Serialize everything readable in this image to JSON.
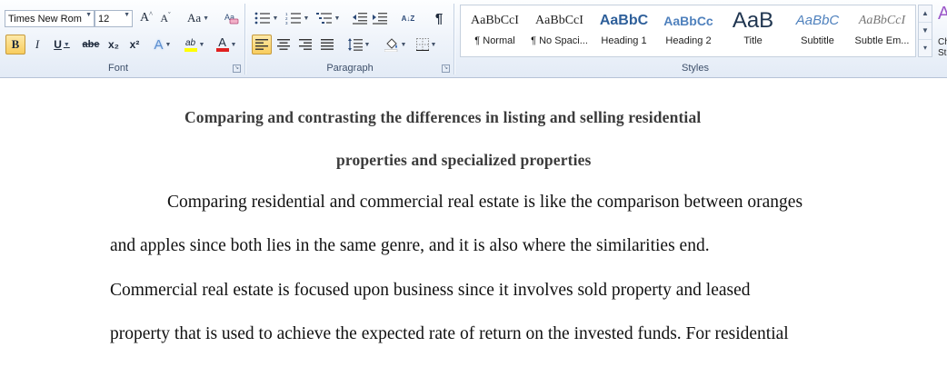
{
  "ribbon": {
    "font": {
      "name_value": "Times New Rom",
      "size_value": "12",
      "grow_label": "A",
      "shrink_label": "A",
      "case_label": "Aa",
      "bold_label": "B",
      "italic_label": "I",
      "underline_label": "U",
      "strike_label": "abe",
      "subscript_label": "x₂",
      "superscript_label": "x²",
      "effects_label": "A",
      "highlight_label": "ab",
      "color_label": "A",
      "group_label": "Font",
      "highlight_color": "#ffff00",
      "font_color": "#e02020"
    },
    "paragraph": {
      "group_label": "Paragraph",
      "sort_label": "A↓Z",
      "pilcrow_label": "¶"
    },
    "styles": {
      "group_label": "Styles",
      "items": [
        {
          "sample": "AaBbCcI",
          "name": "¶ Normal"
        },
        {
          "sample": "AaBbCcI",
          "name": "¶ No Spaci..."
        },
        {
          "sample": "AaBbC",
          "name": "Heading 1"
        },
        {
          "sample": "AaBbCc",
          "name": "Heading 2"
        },
        {
          "sample": "AaB",
          "name": "Title"
        },
        {
          "sample": "AaBbC",
          "name": "Subtitle"
        },
        {
          "sample": "AaBbCcI",
          "name": "Subtle Em..."
        }
      ],
      "change_styles_label_1": "Ch",
      "change_styles_label_2": "St"
    }
  },
  "document": {
    "title_line1": "Comparing and contrasting the differences in listing and selling residential",
    "title_line2": "properties and specialized properties",
    "lines": [
      "Comparing residential and commercial real estate is like the comparison between oranges",
      "and apples since both lies in the same genre, and it is also where the similarities end.",
      "Commercial real estate is focused upon business since it involves sold property and leased",
      "property that is used to achieve the expected rate of return on the invested funds. For residential"
    ]
  }
}
